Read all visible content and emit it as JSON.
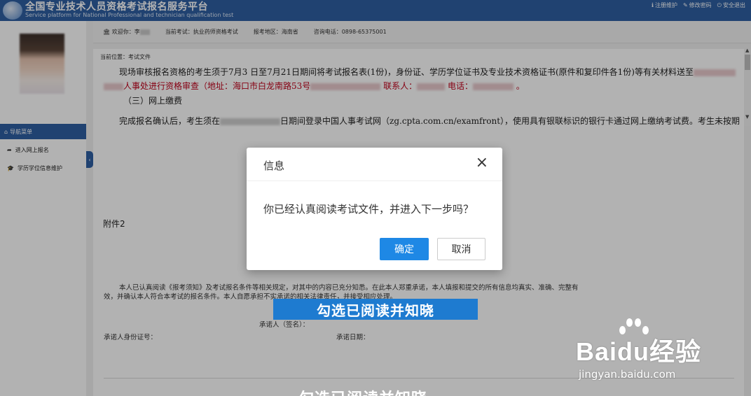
{
  "header": {
    "title": "全国专业技术人员资格考试报名服务平台",
    "subtitle": "Service platform for National Professional and technician qualification test",
    "links": [
      "注册维护",
      "修改密码",
      "安全退出"
    ]
  },
  "sidebar": {
    "nav_title": "导航菜单",
    "items": [
      "进入网上报名",
      "学历学位信息维护"
    ]
  },
  "infobar": {
    "welcome": "欢迎你：李",
    "exam": "当前考试：执业药师资格考试",
    "region": "报考地区：海南省",
    "phone": "咨询电话：0898-65375001"
  },
  "content": {
    "breadcrumb": "当前位置：考试文件",
    "line1": "现场审核报名资格的考生须于7月3 日至7月21日期间将考试报名表(1份)，身份证、学历学位证书及专业技术资格证书(原件和复印件各1份)等有关材料送至",
    "line2a": "人事处进行资格审查（地址：海口市白龙南路53号",
    "line2b": "联系人：",
    "line2c": "电话：",
    "line2d": "。",
    "section": "（三）网上缴费",
    "line3a": "完成报名确认后，考生须在",
    "line3b": "日期间登录中国人事考试网（zg.cpta.com.cn/examfront），使用具有银联标识的银行卡通过网上缴纳考试费。考生未按期",
    "appendix": "附件2",
    "pledge1": "本人已认真阅读《报考须知》及考试报名条件等相关规定，对其中的内容已充分知悉。在此本人郑重承诺，本人填报和提交的所有信息均真实、准确、完整有",
    "pledge2": "效，并确认本人符合本考试的报名条件。本人自愿承担不实承诺的相关法律责任，并接受相应处理。",
    "signer": "承诺人（签名）：",
    "id_label": "承诺人身份证号：",
    "date_label": "承诺日期："
  },
  "captions": {
    "main": "勾选已阅读并知晓",
    "bottom": "勾选已阅读并知晓"
  },
  "watermark": {
    "brand": "Baidu经验",
    "url": "jingyan.baidu.com"
  },
  "modal": {
    "title": "信息",
    "close": "×",
    "message": "你已经认真阅读考试文件，并进入下一步吗？",
    "ok": "确定",
    "cancel": "取消"
  },
  "colors": {
    "brand_blue": "#2e5fa3",
    "primary_button": "#1e88e5",
    "caption_blue": "#1e7bd0",
    "highlight_red": "#c0001a"
  }
}
